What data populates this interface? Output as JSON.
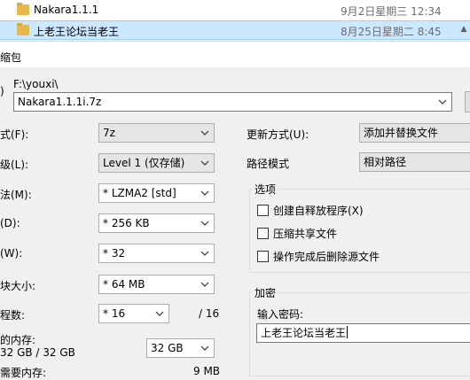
{
  "files": [
    {
      "name": "Nakara1.1.1",
      "date": "9月2日星期三 12:34"
    },
    {
      "name": "上老王论坛当老王",
      "date": "8月25日星期二 8:45"
    }
  ],
  "explorer_scroll_glyph": "▲",
  "dialog": {
    "title_fragment": "缩包",
    "path_label_fragment": ")",
    "folder_path": "F:\\youxi\\",
    "archive_name": "Nakara1.1.1i.7z"
  },
  "left_fields": [
    {
      "label": "式(F):",
      "value": "7z"
    },
    {
      "label": "级(L):",
      "value": "Level 1 (仅存储)"
    },
    {
      "label": "法(M):",
      "value": "* LZMA2 [std]"
    },
    {
      "label": "(D):",
      "value": "* 256 KB"
    },
    {
      "label": "(W):",
      "value": "* 32"
    },
    {
      "label": "块大小:",
      "value": "* 64 MB"
    }
  ],
  "threads": {
    "label": "程数:",
    "value": "* 16",
    "max": "/ 16"
  },
  "memory": {
    "label": "的内存:",
    "sub": "32 GB / 32 GB",
    "value": "32 GB"
  },
  "bottom_cut": {
    "label": "需要内存:",
    "value": "9 MB"
  },
  "update_mode": {
    "label": "更新方式(U):",
    "value": "添加并替换文件"
  },
  "path_mode": {
    "label": "路径模式",
    "value": "相对路径"
  },
  "options": {
    "title": "选项",
    "items": [
      {
        "label": "创建自释放程序(X)",
        "checked": false
      },
      {
        "label": "压缩共享文件",
        "checked": false
      },
      {
        "label": "操作完成后删除源文件",
        "checked": false
      }
    ]
  },
  "encryption": {
    "title": "加密",
    "password_label": "输入密码:",
    "password_value": "上老王论坛当老王"
  }
}
